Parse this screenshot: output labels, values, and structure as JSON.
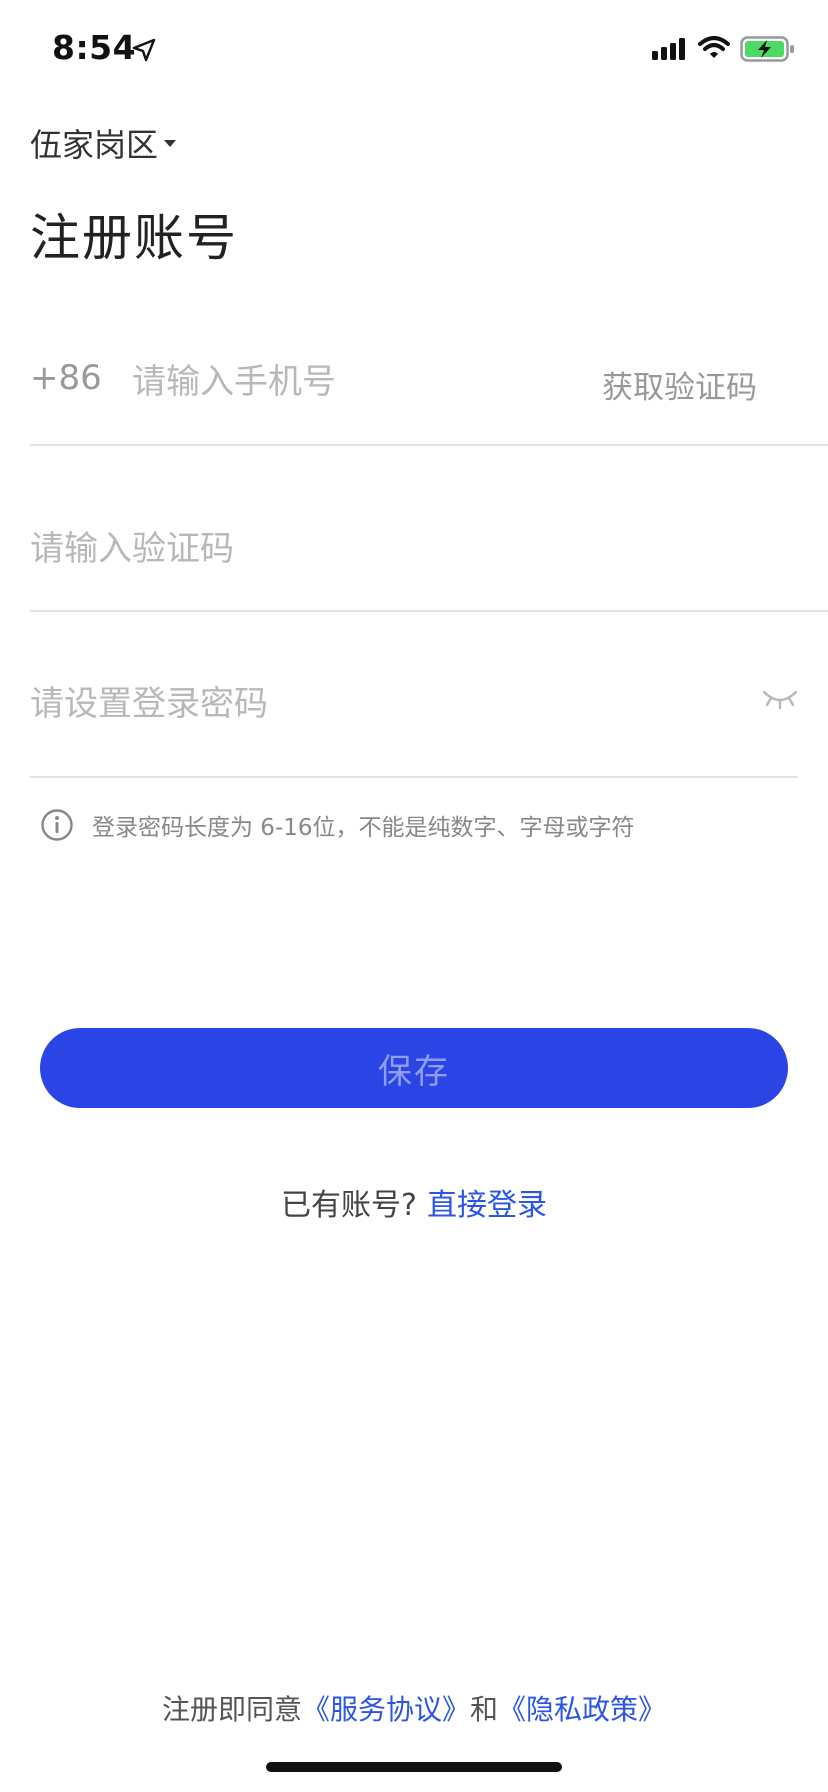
{
  "status_bar": {
    "time": "8:54"
  },
  "header": {
    "region": "伍家岗区",
    "title": "注册账号"
  },
  "form": {
    "country_code": "+86",
    "phone_placeholder": "请输入手机号",
    "get_code_label": "获取验证码",
    "code_placeholder": "请输入验证码",
    "password_placeholder": "请设置登录密码",
    "hint": "登录密码长度为 6-16位，不能是纯数字、字母或字符"
  },
  "save_label": "保存",
  "login_prompt": {
    "text": "已有账号?",
    "link": "直接登录"
  },
  "agreement": {
    "prefix": "注册即同意",
    "service_link": "《服务协议》",
    "conjunction": "和",
    "privacy_link": "《隐私政策》"
  },
  "colors": {
    "primary": "#2b44e6",
    "link": "#2b55e6",
    "battery_green": "#4cd964"
  }
}
